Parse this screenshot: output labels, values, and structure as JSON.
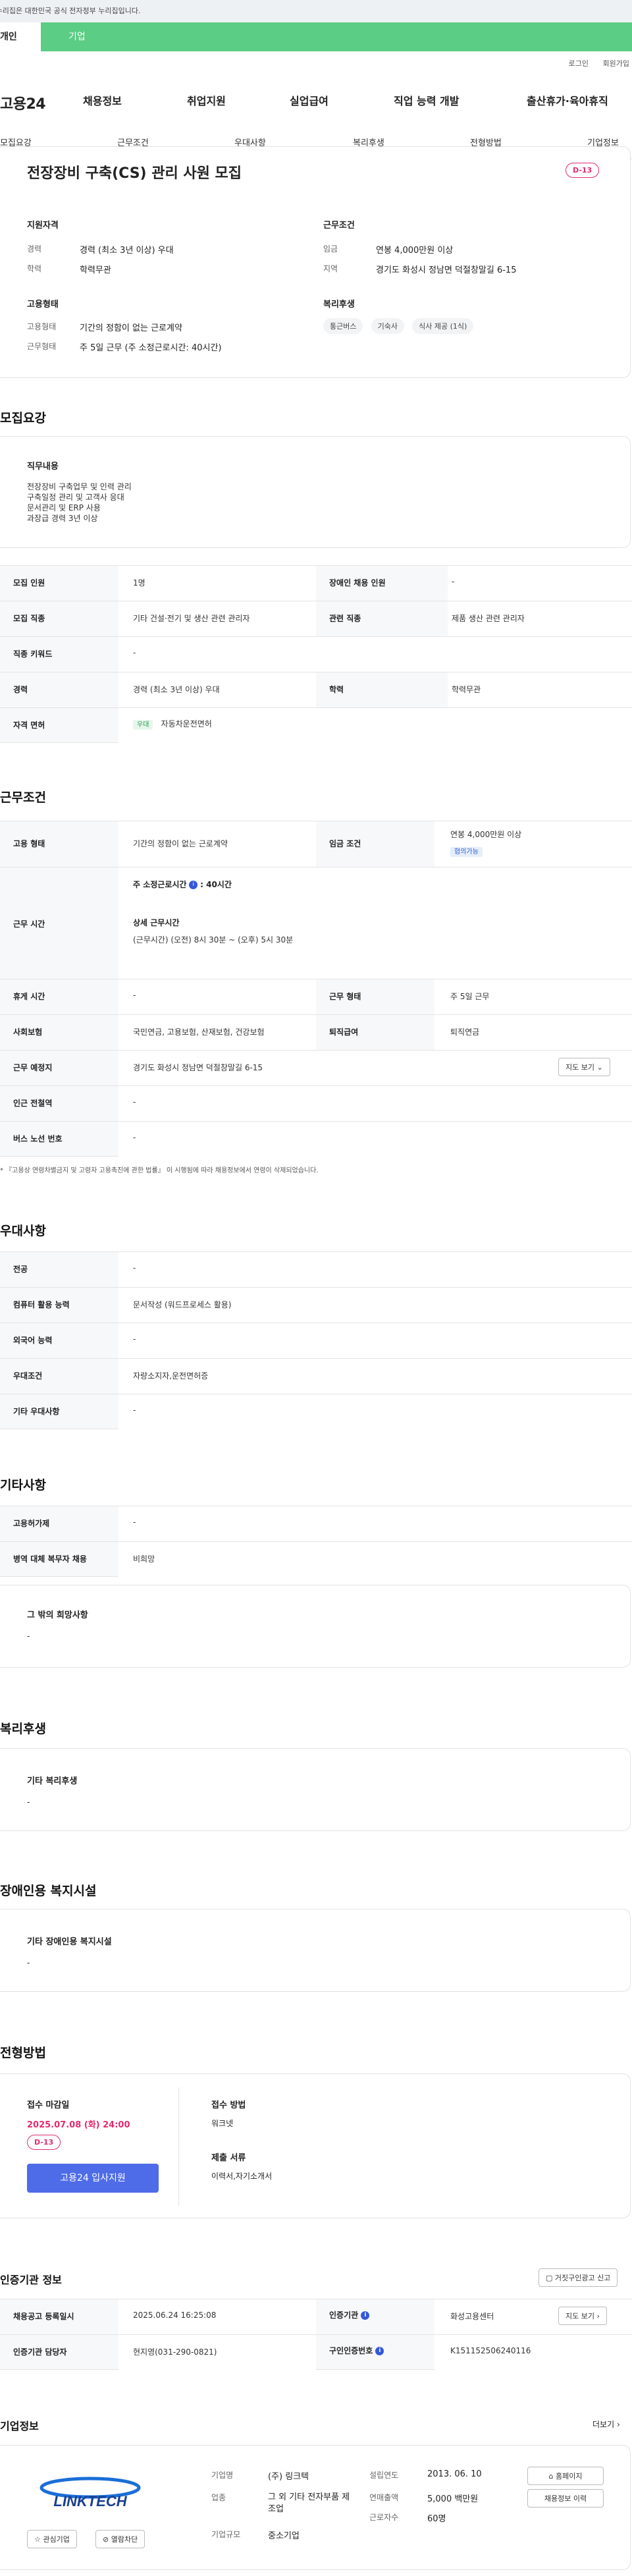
{
  "banner": {
    "text": "이 누리집은 대한민국 공식 전자정부 누리집입니다."
  },
  "tabs": [
    "개인",
    "기업"
  ],
  "util": [
    "로그인",
    "회원가입"
  ],
  "logo": "고용24",
  "gnb": [
    "채용정보",
    "취업지원",
    "실업급여",
    "직업 능력 개발",
    "출산휴가·육아휴직"
  ],
  "subnav": [
    "모집요강",
    "근무조건",
    "우대사항",
    "복리후생",
    "전형방법",
    "기업정보"
  ],
  "summary": {
    "title": "전장장비 구축(CS) 관리 사원 모집",
    "dday": "D-13",
    "qual_title": "지원자격",
    "career_label": "경력",
    "career_value": "경력 (최소 3년 이상) 우대",
    "edu_label": "학력",
    "edu_value": "학력무관",
    "cond_title": "근무조건",
    "wage_label": "임금",
    "wage_value": "연봉 4,000만원 이상",
    "region_label": "지역",
    "region_value": "경기도 화성시 정남면 덕절창말길 6-15",
    "emp_title": "고용형태",
    "emptype_label": "고용형태",
    "emptype_value": "기간의 정함이 없는 근로계약",
    "workform_label": "근무형태",
    "workform_value": "주 5일 근무 (주 소정근로시간: 40시간)",
    "welfare_title": "복리후생",
    "welfare_chips": [
      "통근버스",
      "기숙사",
      "식사 제공 (1식)"
    ]
  },
  "recruit": {
    "heading": "모집요강",
    "duty_title": "직무내용",
    "duty_lines": [
      "전장장비 구축업무 및 인력 관리",
      "구축일정 관리 및 고객사 응대",
      "문서관리 및 ERP 사용",
      "과장급 경력 3년 이상"
    ],
    "rows": [
      {
        "h1": "모집 인원",
        "v1": "1명",
        "h2": "장애인 채용 인원",
        "v2": "-"
      },
      {
        "h1": "모집 직종",
        "v1": "기타 건설·전기 및 생산 관련 관리자",
        "h2": "관련 직종",
        "v2": "제품 생산 관련 관리자"
      },
      {
        "h1": "직종 키워드",
        "v1": "-",
        "h2": "",
        "v2": ""
      },
      {
        "h1": "경력",
        "v1": "경력 (최소 3년 이상) 우대",
        "h2": "학력",
        "v2": "학력무관"
      },
      {
        "h1": "자격 면허",
        "v1": "자동차운전면허",
        "h2": "",
        "v2": ""
      }
    ],
    "license_tag": "우대"
  },
  "work": {
    "heading": "근무조건",
    "emp_h": "고용 형태",
    "emp_v": "기간의 정함이 없는 근로계약",
    "wage_h": "임금 조건",
    "wage_v": "연봉 4,000만원 이상",
    "wage_tag": "협의가능",
    "time_h": "근무 시간",
    "time_week": "주 소정근로시간",
    "time_week_val": ": 40시간",
    "time_detail_title": "상세 근무시간",
    "time_detail": "(근무시간) (오전) 8시 30분 ~ (오후) 5시 30분",
    "rest_h": "휴게 시간",
    "rest_v": "-",
    "form_h": "근무 형태",
    "form_v": "주 5일 근무",
    "ins_h": "사회보험",
    "ins_v": "국민연금, 고용보험, 산재보험, 건강보험",
    "retire_h": "퇴직급여",
    "retire_v": "퇴직연금",
    "place_h": "근무 예정지",
    "place_v": "경기도 화성시 정남면 덕절창말길 6-15",
    "map_btn": "지도 보기",
    "station_h": "인근 전철역",
    "station_v": "-",
    "bus_h": "버스 노선 번호",
    "bus_v": "-",
    "note": "* 『고용상 연령차별금지 및 고령자 고용촉진에 관한 법률』 이 시행됨에 따라 채용정보에서 연령이 삭제되었습니다."
  },
  "pref": {
    "heading": "우대사항",
    "rows": [
      {
        "h": "전공",
        "v": "-"
      },
      {
        "h": "컴퓨터 활용 능력",
        "v": "문서작성 (워드프로세스 활용)"
      },
      {
        "h": "외국어 능력",
        "v": "-"
      },
      {
        "h": "우대조건",
        "v": "자량소지자,운전면허증"
      },
      {
        "h": "기타 우대사항",
        "v": "-"
      }
    ]
  },
  "etc": {
    "heading": "기타사항",
    "rows": [
      {
        "h": "고용허가제",
        "v": "-"
      },
      {
        "h": "병역 대체 복무자 채용",
        "v": "비희망"
      }
    ],
    "box_title": "그 밖의 희망사항",
    "box_value": "-"
  },
  "welfare": {
    "heading": "복리후생",
    "box_title": "기타 복리후생",
    "box_value": "-"
  },
  "disabled": {
    "heading": "장애인용 복지시설",
    "box_title": "기타 장애인용 복지시설",
    "box_value": "-"
  },
  "selection": {
    "heading": "전형방법",
    "deadline_title": "접수 마감일",
    "deadline": "2025.07.08 (화) 24:00",
    "dday": "D-13",
    "apply_btn": "고용24 입사지원",
    "method_title": "접수 방법",
    "method_value": "워크넷",
    "docs_title": "제출 서류",
    "docs_value": "이력서,자기소개서"
  },
  "cert": {
    "heading": "인증기관 정보",
    "report_btn": "거짓구인광고 신고",
    "reg_h": "채용공고 등록일시",
    "reg_v": "2025.06.24 16:25:08",
    "org_h": "인증기관",
    "org_v": "화성고용센터",
    "map_btn": "지도 보기",
    "mgr_h": "인증기관 담당자",
    "mgr_v": "현지영(031-290-0821)",
    "num_h": "구인인증번호",
    "num_v": "K151152506240116"
  },
  "company": {
    "heading": "기업정보",
    "more": "더보기",
    "logo_text": "LINKTECH",
    "interest_btn": "관심기업",
    "block_btn": "열람차단",
    "name_h": "기업명",
    "name_v": "(주) 링크텍",
    "biz_h": "업종",
    "biz_v": "그 외 기타 전자부품 제조업",
    "size_h": "기업규모",
    "size_v": "중소기업",
    "year_h": "설립연도",
    "year_v": "2013. 06. 10",
    "sales_h": "연매출액",
    "sales_v": "5,000 백만원",
    "emp_h": "근로자수",
    "emp_v": "60명",
    "home_btn": "홈페이지",
    "history_btn": "채용정보 이력"
  },
  "colors": {
    "accent": "#5ccd84",
    "dday": "#e22b6f",
    "primary_btn": "#4e6ce8"
  }
}
